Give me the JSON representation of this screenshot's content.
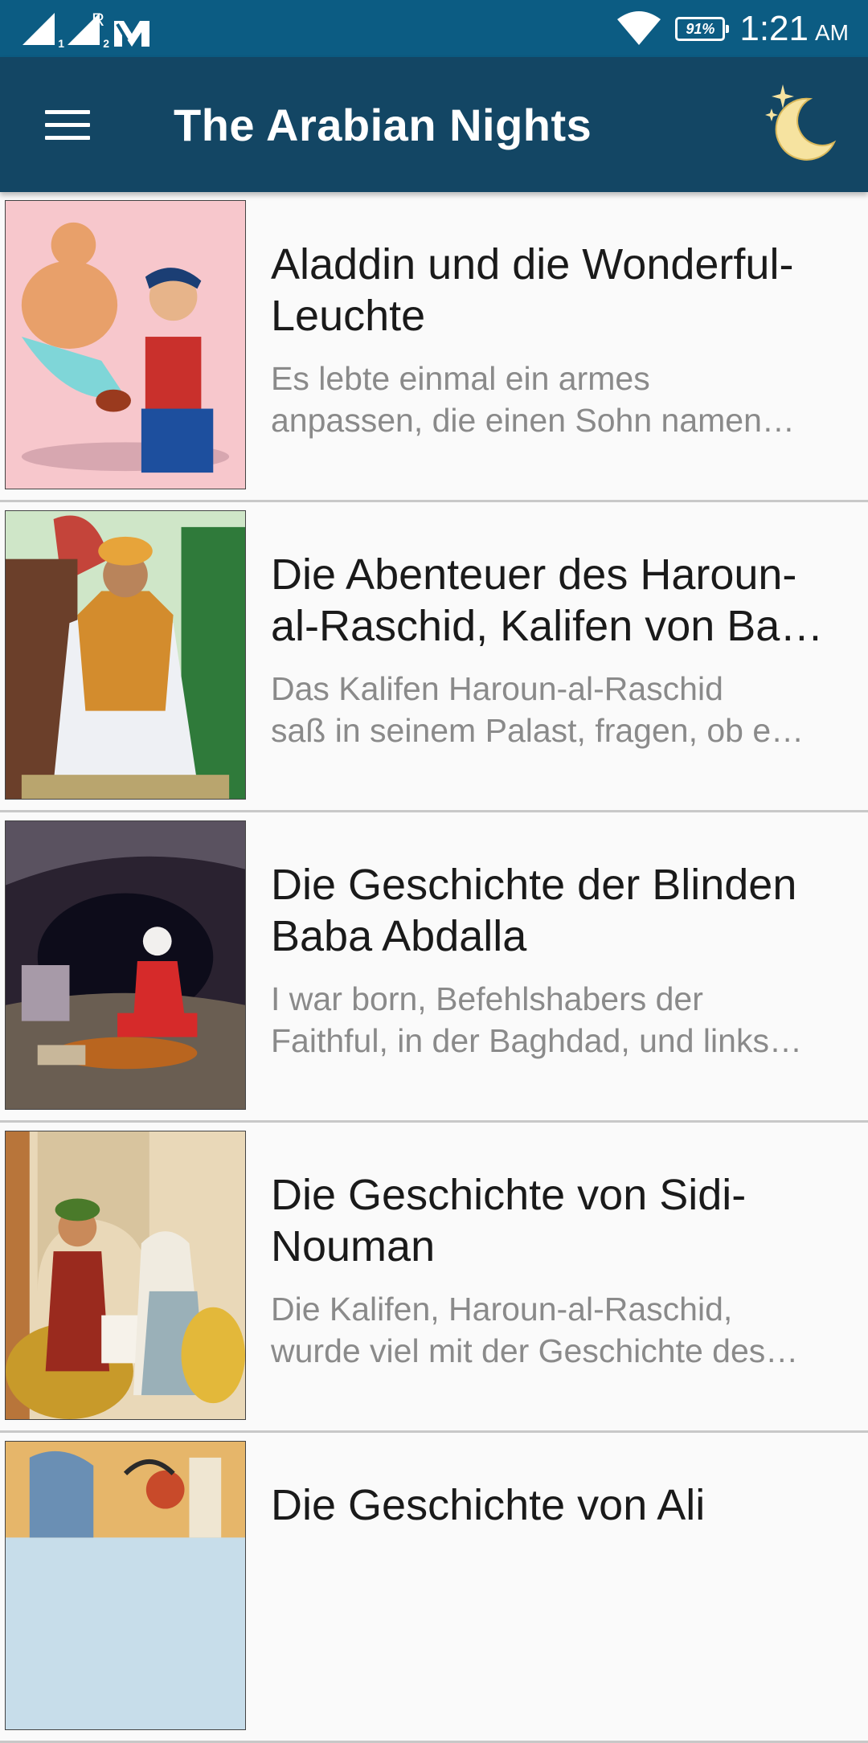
{
  "status_bar": {
    "sim1_label": "1",
    "sim2_label": "2",
    "roaming": "R",
    "battery": "91%",
    "time": "1:21",
    "ampm": "AM"
  },
  "app_bar": {
    "title": "The Arabian Nights",
    "menu_icon": "hamburger-menu-icon",
    "night_mode_icon": "moon-stars-icon"
  },
  "stories": [
    {
      "title": "Aladdin und die Wonderful-Leuchte",
      "excerpt_line1": "Es lebte einmal ein armes",
      "excerpt_line2": "anpassen, die einen Sohn namen…"
    },
    {
      "title": "Die Abenteuer des Haroun-al-Raschid, Kalifen von Ba…",
      "excerpt_line1": "Das Kalifen Haroun-al-Raschid",
      "excerpt_line2": "saß in seinem Palast, fragen, ob e…"
    },
    {
      "title": "Die Geschichte der Blinden Baba Abdalla",
      "excerpt_line1": "I war born, Befehlshabers der",
      "excerpt_line2": "Faithful, in der Baghdad, und links…"
    },
    {
      "title": "Die Geschichte von Sidi-Nouman",
      "excerpt_line1": "Die Kalifen, Haroun-al-Raschid,",
      "excerpt_line2": "wurde viel mit der Geschichte des…"
    },
    {
      "title": "Die Geschichte von Ali",
      "excerpt_line1": "",
      "excerpt_line2": ""
    }
  ],
  "colors": {
    "status_bar": "#0c5c83",
    "app_bar": "#134664",
    "moon": "#f6e3a0",
    "title_text": "#1a1a1a",
    "excerpt_text": "#8a8a8a"
  }
}
